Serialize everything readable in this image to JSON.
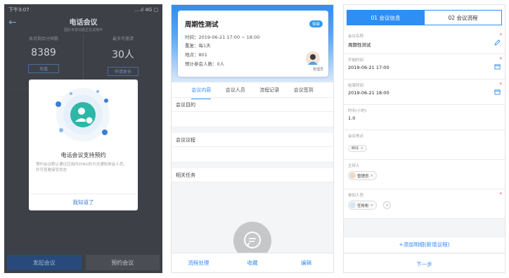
{
  "colors": {
    "accent": "#2f8ef2",
    "required": "#e03b3b",
    "dark_bg": "#3d4046"
  },
  "screen1": {
    "status_time": "下午3:07",
    "status_right": "....ıl 4G ▢",
    "title": "电话会议",
    "subtitle": "团队专享功能正在试用中",
    "stat_left": {
      "label": "本月剩余分钟数",
      "value": "8389",
      "button": "充值"
    },
    "stat_right": {
      "label": "最多可邀请",
      "value": "30人",
      "button": "申请更多"
    },
    "dash_note": "- - - - - - - - - - - -",
    "modal": {
      "title": "电话会议支持预约",
      "body": "预约会议默认通过应用内DING的方式通知参会人员，并可查看接受状态",
      "action": "我知道了"
    },
    "bottom": {
      "primary": "发起会议",
      "secondary": "预约会议"
    }
  },
  "screen2": {
    "card": {
      "title": "周期性测试",
      "badge": "待审",
      "time": "时间：2019-06-21 17:00 ~ 18:00",
      "repeat": "重复：每1天",
      "place": "地点：801",
      "attendees": "预计参会人数：0人",
      "owner": "管理员"
    },
    "tabs": [
      "会议内容",
      "会议人员",
      "流程记录",
      "会议签到"
    ],
    "sections": [
      "会议目的",
      "会议议程",
      "相关任务"
    ],
    "actions": [
      "流程处理",
      "收藏",
      "编辑"
    ]
  },
  "screen3": {
    "segments": [
      "01 会议信息",
      "02 会议流程"
    ],
    "fields": {
      "name": {
        "label": "会议名称",
        "value": "周期性测试"
      },
      "start": {
        "label": "开始时间",
        "value": "2019-06-21 17:00"
      },
      "end": {
        "label": "结束时间",
        "value": "2019-06-21 18:00"
      },
      "duration": {
        "label": "时长(小时)",
        "value": "1.0"
      },
      "place": {
        "label": "会议地点",
        "chip": "801"
      },
      "host": {
        "label": "主持人",
        "chip": "管理员"
      },
      "participants": {
        "label": "参加人员",
        "chip": "任彬彬"
      }
    },
    "add_link": "+添加明细(新增议程)",
    "next": "下一步",
    "required_mark": "*",
    "chip_close": "×",
    "plus": "+"
  }
}
